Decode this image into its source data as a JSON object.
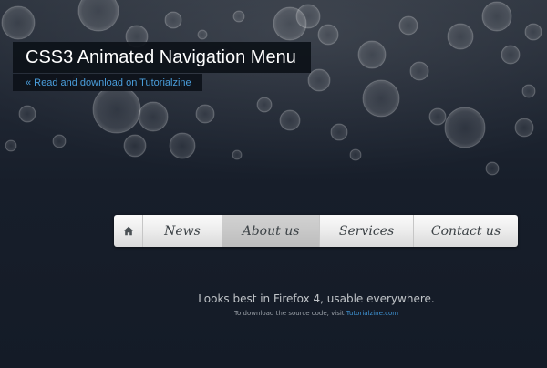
{
  "header": {
    "title": "CSS3 Animated Navigation Menu",
    "subtitle_link": "« Read and download on Tutorialzine"
  },
  "nav": {
    "home_icon": "home-icon",
    "items": [
      {
        "label": "News"
      },
      {
        "label": "About us",
        "active": true
      },
      {
        "label": "Services"
      },
      {
        "label": "Contact us"
      }
    ]
  },
  "footer": {
    "main": "Looks best in Firefox 4, usable everywhere.",
    "sub_prefix": "To download the source code, visit",
    "sub_link": "Tutorialzine.com"
  },
  "colors": {
    "background": "#161d28",
    "link": "#4a9edc",
    "nav_text": "#3c4246"
  }
}
